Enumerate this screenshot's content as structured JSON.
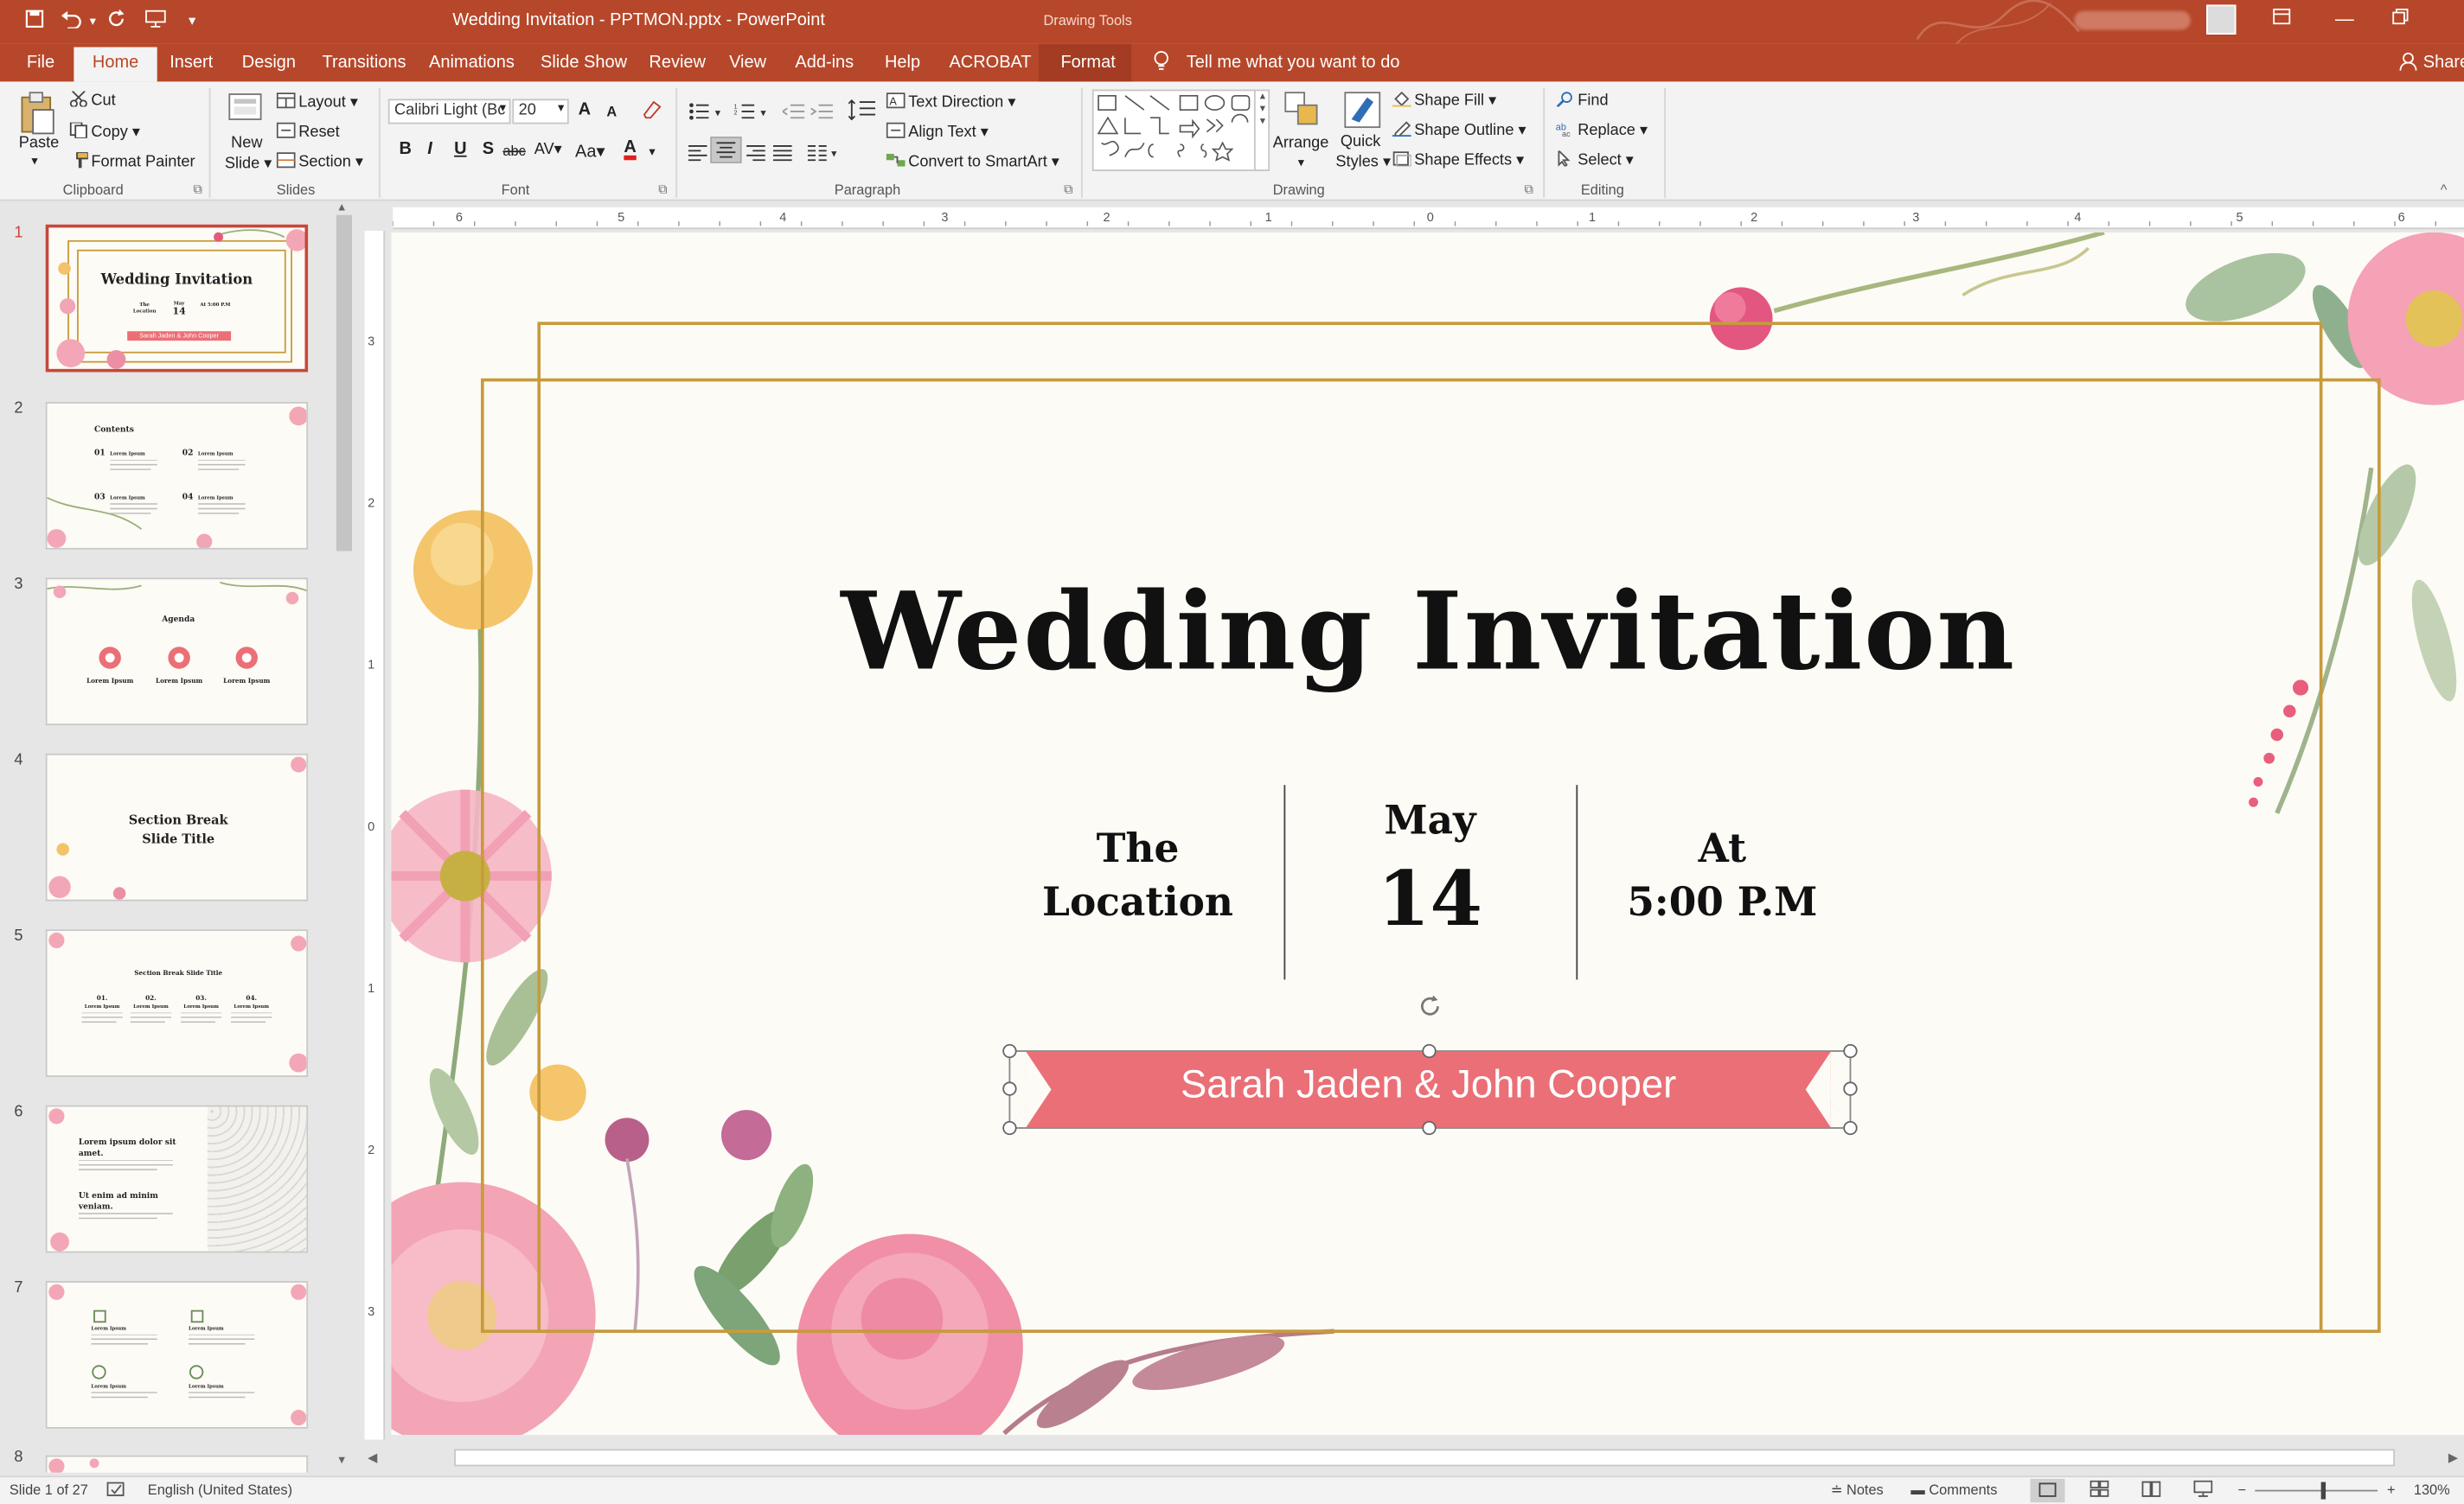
{
  "window": {
    "title": "Wedding Invitation - PPTMON.pptx  -  PowerPoint",
    "contextual_group": "Drawing Tools",
    "share_label": "Share"
  },
  "ribbon_tabs": [
    "File",
    "Home",
    "Insert",
    "Design",
    "Transitions",
    "Animations",
    "Slide Show",
    "Review",
    "View",
    "Add-ins",
    "Help",
    "ACROBAT",
    "Format"
  ],
  "tell_me": "Tell me what you want to do",
  "clipboard": {
    "paste": "Paste",
    "cut": "Cut",
    "copy": "Copy",
    "format_painter": "Format Painter",
    "group": "Clipboard"
  },
  "slides_group": {
    "new_slide_1": "New",
    "new_slide_2": "Slide",
    "layout": "Layout",
    "reset": "Reset",
    "section": "Section",
    "group": "Slides"
  },
  "font": {
    "name": "Calibri Light (Bc",
    "size": "20",
    "bold": "B",
    "italic": "I",
    "underline": "U",
    "shadow": "S",
    "strike": "abc",
    "spacing": "AV",
    "case": "Aa",
    "color": "A",
    "grow": "A",
    "shrink": "A",
    "group": "Font"
  },
  "paragraph": {
    "text_direction": "Text Direction",
    "align_text": "Align Text",
    "convert_smartart": "Convert to SmartArt",
    "group": "Paragraph"
  },
  "drawing": {
    "arrange": "Arrange",
    "quick_styles_1": "Quick",
    "quick_styles_2": "Styles",
    "shape_fill": "Shape Fill",
    "shape_outline": "Shape Outline",
    "shape_effects": "Shape Effects",
    "group": "Drawing"
  },
  "editing": {
    "find": "Find",
    "replace": "Replace",
    "select": "Select",
    "group": "Editing"
  },
  "thumbnails": [
    {
      "num": "1",
      "title": "Wedding Invitation",
      "banner": "Sarah Jaden & John Cooper",
      "c1": "The Location",
      "c2": "May",
      "c2b": "14",
      "c3": "At 5:00 P.M"
    },
    {
      "num": "2",
      "title": "Contents",
      "items": [
        "01",
        "02",
        "03",
        "04"
      ],
      "item_title": "Lorem Ipsum"
    },
    {
      "num": "3",
      "title": "Agenda",
      "items": [
        "Lorem Ipsum",
        "Lorem Ipsum",
        "Lorem Ipsum"
      ]
    },
    {
      "num": "4",
      "title": "Section Break",
      "title2": "Slide Title"
    },
    {
      "num": "5",
      "title": "Section Break Slide Title",
      "items": [
        "01.",
        "02.",
        "03.",
        "04."
      ],
      "item_title": "Lorem Ipsum"
    },
    {
      "num": "6",
      "title": "Lorem ipsum dolor sit",
      "title2": "amet.",
      "sub": "Ut enim ad minim",
      "sub2": "veniam."
    },
    {
      "num": "7",
      "items": [
        "Lorem Ipsum",
        "Lorem Ipsum",
        "Lorem Ipsum",
        "Lorem Ipsum"
      ]
    },
    {
      "num": "8"
    }
  ],
  "ruler": {
    "h": [
      "6",
      "5",
      "4",
      "3",
      "2",
      "1",
      "0",
      "1",
      "2",
      "3",
      "4",
      "5",
      "6"
    ],
    "v": [
      "3",
      "2",
      "1",
      "0",
      "1",
      "2",
      "3"
    ]
  },
  "slide": {
    "title": "Wedding Invitation",
    "location_1": "The",
    "location_2": "Location",
    "month": "May",
    "day": "14",
    "at": "At",
    "time": "5:00 P.M",
    "names": "Sarah Jaden & John Cooper"
  },
  "status": {
    "slide_info": "Slide 1 of 27",
    "language": "English (United States)",
    "notes": "Notes",
    "comments": "Comments",
    "zoom": "130%"
  },
  "colors": {
    "accent": "#b7472a",
    "banner": "#eb6f76",
    "frame": "#c79b3b",
    "slide_bg": "#fdfbf6"
  }
}
